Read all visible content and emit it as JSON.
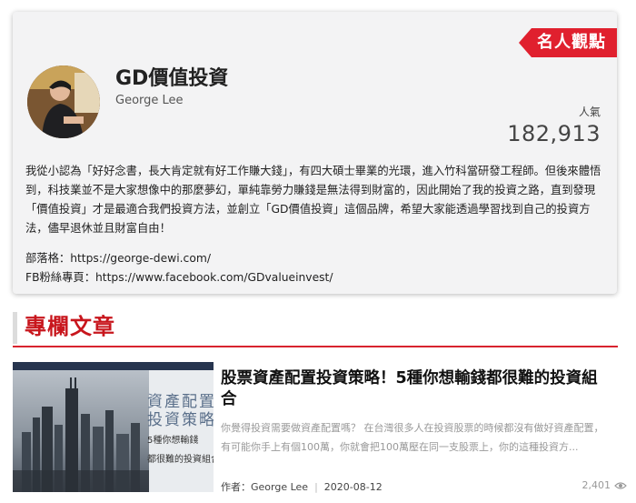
{
  "profile": {
    "badge": "名人觀點",
    "name": "GD價值投資",
    "author": "George Lee",
    "popularity_label": "人氣",
    "popularity_value": "182,913",
    "bio": "我從小認為「好好念書，長大肯定就有好工作賺大錢」，有四大碩士畢業的光環，進入竹科當研發工程師。但後來體悟到，科技業並不是大家想像中的那麼夢幻，單純靠勞力賺錢是無法得到財富的，因此開始了我的投資之路，直到發現「價值投資」才是最適合我們投資方法，並創立「GD價值投資」這個品牌，希望大家能透過學習找到自己的投資方法，儘早退休並且財富自由！",
    "blog_line": "部落格：https://george-dewi.com/",
    "fb_line": "FB粉絲專頁：https://www.facebook.com/GDvalueinvest/"
  },
  "section": {
    "title": "專欄文章"
  },
  "articles": [
    {
      "thumb_text_1": "資產配置",
      "thumb_text_2": "投資策略",
      "thumb_text_3": "5種你想輸錢",
      "thumb_text_4": "都很難的投資組合",
      "title": "股票資產配置投資策略！5種你想輸錢都很難的投資組合",
      "excerpt": "你覺得投資需要做資產配置嗎？ 在台灣很多人在投資股票的時候都沒有做好資產配置，有可能你手上有個100萬，你就會把100萬壓在同一支股票上，你的這種投資方...",
      "author_label": "作者：George Lee",
      "date": "2020-08-12",
      "views": "2,401"
    }
  ]
}
